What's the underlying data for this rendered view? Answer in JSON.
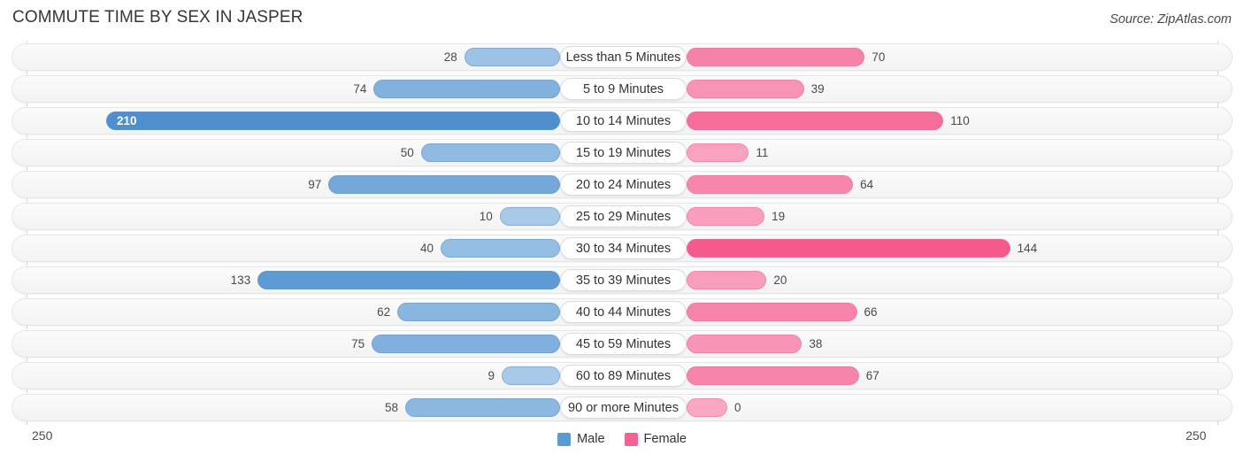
{
  "header": {
    "title": "COMMUTE TIME BY SEX IN JASPER",
    "source": "Source: ZipAtlas.com"
  },
  "axis": {
    "min_label": "250",
    "max_label": "250"
  },
  "legend": {
    "items": [
      {
        "label": "Male",
        "color": "#5b9bd5"
      },
      {
        "label": "Female",
        "color": "#f4628f"
      }
    ]
  },
  "chart_data": {
    "type": "bar",
    "orientation": "horizontal-diverging",
    "title": "COMMUTE TIME BY SEX IN JASPER",
    "xlabel": "",
    "ylabel": "",
    "xlim": [
      250,
      250
    ],
    "grid": true,
    "legend_position": "bottom-center",
    "categories": [
      "Less than 5 Minutes",
      "5 to 9 Minutes",
      "10 to 14 Minutes",
      "15 to 19 Minutes",
      "20 to 24 Minutes",
      "25 to 29 Minutes",
      "30 to 34 Minutes",
      "35 to 39 Minutes",
      "40 to 44 Minutes",
      "45 to 59 Minutes",
      "60 to 89 Minutes",
      "90 or more Minutes"
    ],
    "series": [
      {
        "name": "Male",
        "side": "left",
        "color": "#5b9bd5",
        "values": [
          28,
          74,
          210,
          50,
          97,
          10,
          40,
          133,
          62,
          75,
          9,
          58
        ]
      },
      {
        "name": "Female",
        "side": "right",
        "color": "#f4628f",
        "values": [
          70,
          39,
          110,
          11,
          64,
          19,
          144,
          20,
          66,
          38,
          67,
          0
        ]
      }
    ]
  }
}
